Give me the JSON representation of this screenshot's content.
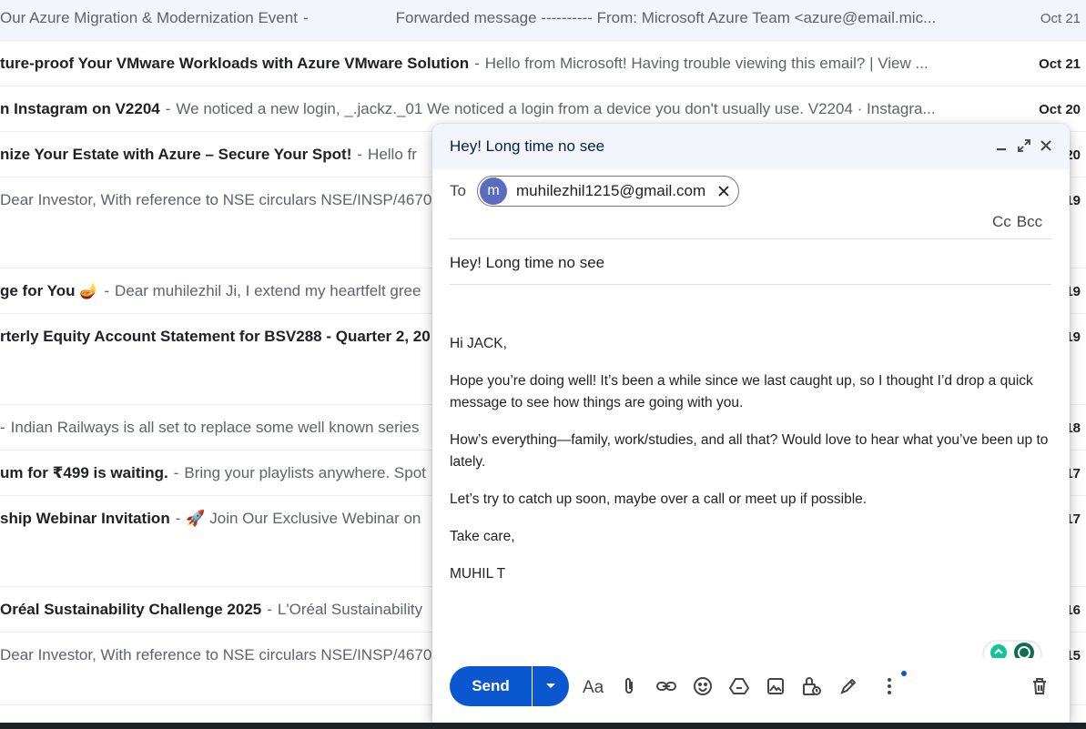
{
  "inbox": {
    "rows": [
      {
        "subject": "Our Azure Migration & Modernization Event",
        "snippet": "Forwarded message ---------- From: Microsoft Azure Team <azure@email.mic...",
        "date": "Oct 21",
        "read": true
      },
      {
        "subject": "ture-proof Your VMware Workloads with Azure VMware Solution",
        "snippet": "Hello from Microsoft! Having trouble viewing this email? | View ...",
        "date": "Oct 21",
        "read": false
      },
      {
        "subject": "n Instagram on V2204",
        "snippet": "We noticed a new login, _.jackz._01 We noticed a login from a device you don't usually use. V2204 · Instagra...",
        "date": "Oct 20",
        "read": false
      },
      {
        "subject": "nize Your Estate with Azure – Secure Your Spot!",
        "snippet": "Hello fr",
        "date": "20",
        "read": false
      },
      {
        "subject": "",
        "snippet": "Dear Investor, With reference to NSE circulars NSE/INSP/4670",
        "date": "19",
        "read": false
      },
      {
        "subject": "ge for You 🪔",
        "snippet": "Dear muhilezhil Ji, I extend my heartfelt gree",
        "date": "19",
        "read": false
      },
      {
        "subject": "rterly Equity Account Statement for BSV288 - Quarter 2, 20",
        "snippet": "",
        "date": "19",
        "read": false
      },
      {
        "subject": "",
        "snippet": "Indian Railways is all set to replace some well known series",
        "date": "18",
        "read": false
      },
      {
        "subject": "um for ₹499 is waiting.",
        "snippet": "Bring your playlists anywhere. Spot",
        "date": "17",
        "read": false
      },
      {
        "subject": "ship Webinar Invitation",
        "snippet": "🚀 Join Our Exclusive Webinar on",
        "date": "17",
        "read": false
      },
      {
        "subject": "Oréal Sustainability Challenge 2025",
        "snippet": "L'Oréal Sustainability",
        "date": "16",
        "read": false
      },
      {
        "subject": "",
        "snippet": "Dear Investor, With reference to NSE circulars NSE/INSP/4670",
        "date": "15",
        "read": false
      }
    ]
  },
  "compose": {
    "title": "Hey! Long time no see",
    "to_label": "To",
    "recipient": {
      "avatar_letter": "m",
      "email": "muhilezhil1215@gmail.com",
      "avatar_color": "#5c6bc0"
    },
    "cc_label": "Cc",
    "bcc_label": "Bcc",
    "subject": "Hey! Long time no see",
    "body": [
      "Hi JACK,",
      "Hope you’re doing well! It’s been a while since we last caught up, so I thought I’d drop a quick message to see how things are going with you.",
      "How’s everything—family, work/studies, and all that? Would love to hear what you’ve been up to lately.",
      "Let’s try to catch up soon, maybe over a call or meet up if possible.",
      "Take care,",
      "MUHIL T"
    ],
    "send_label": "Send",
    "toolbar_icons": [
      "text-format-icon",
      "attachment-icon",
      "link-icon",
      "emoji-icon",
      "drive-icon",
      "photo-icon",
      "confidential-lock-icon",
      "signature-pen-icon",
      "more-options-icon",
      "delete-trash-icon"
    ]
  },
  "colors": {
    "accent": "#0b57d0",
    "header_bg": "#f2f6fc",
    "title_text": "#041e49"
  }
}
